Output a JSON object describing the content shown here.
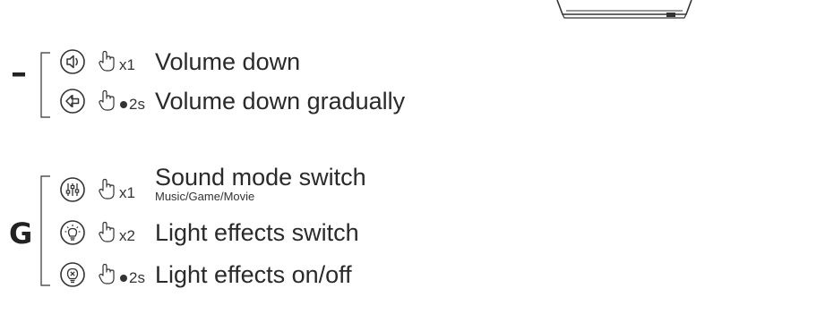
{
  "groups": [
    {
      "key": "–",
      "items": [
        {
          "icon": "volume-down-icon",
          "count": "x1",
          "hold": false,
          "label": "Volume down",
          "sublabel": ""
        },
        {
          "icon": "volume-down-gradual-icon",
          "count": "2s",
          "hold": true,
          "label": "Volume down gradually",
          "sublabel": ""
        }
      ]
    },
    {
      "key": "G",
      "items": [
        {
          "icon": "equalizer-icon",
          "count": "x1",
          "hold": false,
          "label": "Sound mode switch",
          "sublabel": "Music/Game/Movie"
        },
        {
          "icon": "lightbulb-icon",
          "count": "x2",
          "hold": false,
          "label": "Light effects switch",
          "sublabel": ""
        },
        {
          "icon": "lightbulb-off-icon",
          "count": "2s",
          "hold": true,
          "label": "Light effects on/off",
          "sublabel": ""
        }
      ]
    }
  ],
  "colors": {
    "text": "#2a2a2a",
    "stroke": "#333333",
    "background": "#ffffff"
  }
}
